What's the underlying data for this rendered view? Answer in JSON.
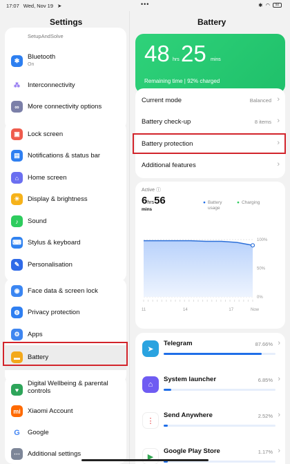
{
  "status": {
    "time": "17:07",
    "date": "Wed, Nov 19",
    "battery": "92"
  },
  "left": {
    "title": "Settings",
    "top_item": "SetupAndSolve",
    "group1": [
      {
        "icon": "bluetooth-icon",
        "label": "Bluetooth",
        "sub": "On",
        "color": "#2d7ff0"
      },
      {
        "icon": "interconnectivity-icon",
        "label": "Interconnectivity",
        "color": "#8a6cf0"
      },
      {
        "icon": "link-icon",
        "label": "More connectivity options",
        "color": "#7b7fa8"
      }
    ],
    "group2": [
      {
        "icon": "lock-icon",
        "label": "Lock screen",
        "color": "#ef5b4d"
      },
      {
        "icon": "notifications-icon",
        "label": "Notifications & status bar",
        "color": "#2f7ff1"
      },
      {
        "icon": "home-icon",
        "label": "Home screen",
        "color": "#6b6ff0"
      },
      {
        "icon": "display-icon",
        "label": "Display & brightness",
        "color": "#f6b21a"
      },
      {
        "icon": "sound-icon",
        "label": "Sound",
        "color": "#2ecc5e"
      },
      {
        "icon": "stylus-icon",
        "label": "Stylus & keyboard",
        "color": "#3183f0"
      },
      {
        "icon": "personalisation-icon",
        "label": "Personalisation",
        "color": "#2f6ae8"
      }
    ],
    "group3": [
      {
        "icon": "face-icon",
        "label": "Face data & screen lock",
        "color": "#3b86f2"
      },
      {
        "icon": "privacy-icon",
        "label": "Privacy protection",
        "color": "#2f7ff1"
      },
      {
        "icon": "apps-icon",
        "label": "Apps",
        "color": "#3f86f0"
      },
      {
        "icon": "battery-icon",
        "label": "Battery",
        "color": "#f3a91c"
      }
    ],
    "group4": [
      {
        "icon": "wellbeing-icon",
        "label": "Digital Wellbeing & parental controls",
        "color": "#2ea55a"
      },
      {
        "icon": "xiaomi-icon",
        "label": "Xiaomi Account",
        "color": "#ff6a00"
      },
      {
        "icon": "google-icon",
        "label": "Google",
        "color": "#ffffff"
      },
      {
        "icon": "additional-settings-icon",
        "label": "Additional settings",
        "color": "#7d8698"
      }
    ]
  },
  "right": {
    "title": "Battery",
    "hours": "48",
    "hrs": "hrs",
    "mins_val": "25",
    "mins": "mins",
    "remaining": "Remaining time | 92% charged",
    "menu": [
      {
        "label": "Current mode",
        "value": "Balanced"
      },
      {
        "label": "Battery check-up",
        "value": "8 items"
      },
      {
        "label": "Battery protection",
        "value": ""
      },
      {
        "label": "Additional features",
        "value": ""
      }
    ],
    "active_label": "Active",
    "active_h": "6",
    "active_hrs": "hrs",
    "active_m": "56",
    "active_mins": "mins",
    "legend_usage": "Battery usage",
    "legend_charging": "Charging",
    "chart_data": {
      "type": "area",
      "x": [
        "11",
        "14",
        "17",
        "Now"
      ],
      "y_ticks": [
        "100%",
        "50%",
        "0%"
      ],
      "values": [
        98,
        98,
        98,
        98,
        97,
        97,
        95,
        90
      ],
      "ylim": [
        0,
        100
      ]
    },
    "apps": [
      {
        "icon": "telegram-icon",
        "name": "Telegram",
        "pct": "87.66%",
        "frac": 0.8766,
        "color": "#2aa3e0"
      },
      {
        "icon": "launcher-icon",
        "name": "System launcher",
        "pct": "6.85%",
        "frac": 0.0685,
        "color": "#6f5cf2"
      },
      {
        "icon": "send-anywhere-icon",
        "name": "Send Anywhere",
        "pct": "2.52%",
        "frac": 0.0252,
        "color": "#ffffff"
      },
      {
        "icon": "play-store-icon",
        "name": "Google Play Store",
        "pct": "1.17%",
        "frac": 0.0117,
        "color": "#ffffff"
      }
    ]
  }
}
